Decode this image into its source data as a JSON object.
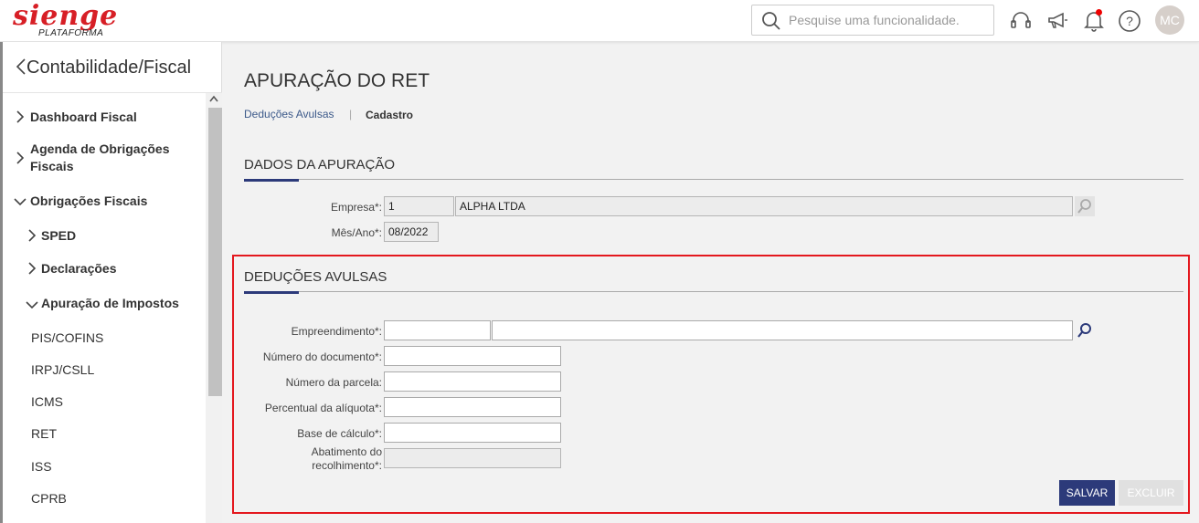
{
  "header": {
    "logo_main": "sienge",
    "logo_sub": "PLATAFORMA",
    "search_placeholder": "Pesquise uma funcionalidade.",
    "avatar_initials": "MC",
    "icons": [
      "headset-icon",
      "megaphone-icon",
      "bell-icon",
      "help-icon"
    ],
    "notification_color": "#e00000"
  },
  "sidebar": {
    "title": "Contabilidade/Fiscal",
    "items": [
      {
        "label": "Dashboard Fiscal",
        "bold": true,
        "chevron": "right"
      },
      {
        "label": "Agenda de Obrigações",
        "label2": "Fiscais",
        "bold": true,
        "chevron": "right"
      },
      {
        "label": "Obrigações Fiscais",
        "bold": true,
        "chevron": "down"
      },
      {
        "label": "SPED",
        "bold": true,
        "chevron": "right"
      },
      {
        "label": "Declarações",
        "bold": true,
        "chevron": "right"
      },
      {
        "label": "Apuração de Impostos",
        "bold": true,
        "chevron": "down"
      },
      {
        "label": "PIS/COFINS"
      },
      {
        "label": "IRPJ/CSLL"
      },
      {
        "label": "ICMS"
      },
      {
        "label": "RET"
      },
      {
        "label": "ISS"
      },
      {
        "label": "CPRB"
      }
    ]
  },
  "main": {
    "title": "APURAÇÃO DO RET",
    "breadcrumb": {
      "link": "Deduções Avulsas",
      "separator": "|",
      "current": "Cadastro"
    },
    "dados": {
      "title": "DADOS DA APURAÇÃO",
      "empresa_label": "Empresa*:",
      "empresa_code": "1",
      "empresa_name": "ALPHA LTDA",
      "mesano_label": "Mês/Ano*:",
      "mesano_value": "08/2022"
    },
    "deducoes": {
      "title": "DEDUÇÕES AVULSAS",
      "empreendimento_label": "Empreendimento*:",
      "num_doc_label": "Número do documento*:",
      "num_parcela_label": "Número da parcela:",
      "percentual_label": "Percentual da alíquota*:",
      "base_label": "Base de cálculo*:",
      "abatimento_label1": "Abatimento do",
      "abatimento_label2": "recolhimento*:"
    },
    "buttons": {
      "save": "SALVAR",
      "delete": "EXCLUIR"
    },
    "accent_color": "#2c3a7a",
    "highlight_color": "#e4181e"
  }
}
